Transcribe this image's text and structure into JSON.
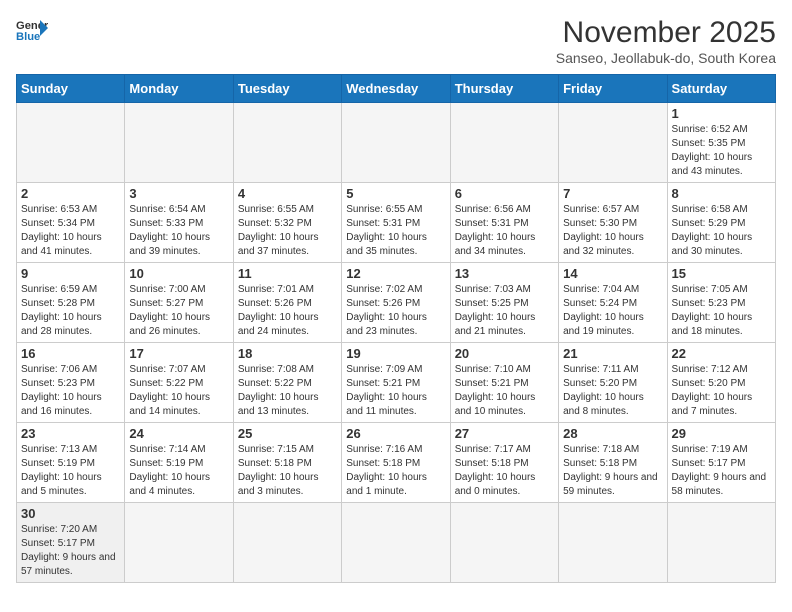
{
  "logo": {
    "text_general": "General",
    "text_blue": "Blue"
  },
  "header": {
    "month": "November 2025",
    "location": "Sanseo, Jeollabuk-do, South Korea"
  },
  "days_of_week": [
    "Sunday",
    "Monday",
    "Tuesday",
    "Wednesday",
    "Thursday",
    "Friday",
    "Saturday"
  ],
  "weeks": [
    [
      {
        "day": "",
        "info": ""
      },
      {
        "day": "",
        "info": ""
      },
      {
        "day": "",
        "info": ""
      },
      {
        "day": "",
        "info": ""
      },
      {
        "day": "",
        "info": ""
      },
      {
        "day": "",
        "info": ""
      },
      {
        "day": "1",
        "info": "Sunrise: 6:52 AM\nSunset: 5:35 PM\nDaylight: 10 hours and 43 minutes."
      }
    ],
    [
      {
        "day": "2",
        "info": "Sunrise: 6:53 AM\nSunset: 5:34 PM\nDaylight: 10 hours and 41 minutes."
      },
      {
        "day": "3",
        "info": "Sunrise: 6:54 AM\nSunset: 5:33 PM\nDaylight: 10 hours and 39 minutes."
      },
      {
        "day": "4",
        "info": "Sunrise: 6:55 AM\nSunset: 5:32 PM\nDaylight: 10 hours and 37 minutes."
      },
      {
        "day": "5",
        "info": "Sunrise: 6:55 AM\nSunset: 5:31 PM\nDaylight: 10 hours and 35 minutes."
      },
      {
        "day": "6",
        "info": "Sunrise: 6:56 AM\nSunset: 5:31 PM\nDaylight: 10 hours and 34 minutes."
      },
      {
        "day": "7",
        "info": "Sunrise: 6:57 AM\nSunset: 5:30 PM\nDaylight: 10 hours and 32 minutes."
      },
      {
        "day": "8",
        "info": "Sunrise: 6:58 AM\nSunset: 5:29 PM\nDaylight: 10 hours and 30 minutes."
      }
    ],
    [
      {
        "day": "9",
        "info": "Sunrise: 6:59 AM\nSunset: 5:28 PM\nDaylight: 10 hours and 28 minutes."
      },
      {
        "day": "10",
        "info": "Sunrise: 7:00 AM\nSunset: 5:27 PM\nDaylight: 10 hours and 26 minutes."
      },
      {
        "day": "11",
        "info": "Sunrise: 7:01 AM\nSunset: 5:26 PM\nDaylight: 10 hours and 24 minutes."
      },
      {
        "day": "12",
        "info": "Sunrise: 7:02 AM\nSunset: 5:26 PM\nDaylight: 10 hours and 23 minutes."
      },
      {
        "day": "13",
        "info": "Sunrise: 7:03 AM\nSunset: 5:25 PM\nDaylight: 10 hours and 21 minutes."
      },
      {
        "day": "14",
        "info": "Sunrise: 7:04 AM\nSunset: 5:24 PM\nDaylight: 10 hours and 19 minutes."
      },
      {
        "day": "15",
        "info": "Sunrise: 7:05 AM\nSunset: 5:23 PM\nDaylight: 10 hours and 18 minutes."
      }
    ],
    [
      {
        "day": "16",
        "info": "Sunrise: 7:06 AM\nSunset: 5:23 PM\nDaylight: 10 hours and 16 minutes."
      },
      {
        "day": "17",
        "info": "Sunrise: 7:07 AM\nSunset: 5:22 PM\nDaylight: 10 hours and 14 minutes."
      },
      {
        "day": "18",
        "info": "Sunrise: 7:08 AM\nSunset: 5:22 PM\nDaylight: 10 hours and 13 minutes."
      },
      {
        "day": "19",
        "info": "Sunrise: 7:09 AM\nSunset: 5:21 PM\nDaylight: 10 hours and 11 minutes."
      },
      {
        "day": "20",
        "info": "Sunrise: 7:10 AM\nSunset: 5:21 PM\nDaylight: 10 hours and 10 minutes."
      },
      {
        "day": "21",
        "info": "Sunrise: 7:11 AM\nSunset: 5:20 PM\nDaylight: 10 hours and 8 minutes."
      },
      {
        "day": "22",
        "info": "Sunrise: 7:12 AM\nSunset: 5:20 PM\nDaylight: 10 hours and 7 minutes."
      }
    ],
    [
      {
        "day": "23",
        "info": "Sunrise: 7:13 AM\nSunset: 5:19 PM\nDaylight: 10 hours and 5 minutes."
      },
      {
        "day": "24",
        "info": "Sunrise: 7:14 AM\nSunset: 5:19 PM\nDaylight: 10 hours and 4 minutes."
      },
      {
        "day": "25",
        "info": "Sunrise: 7:15 AM\nSunset: 5:18 PM\nDaylight: 10 hours and 3 minutes."
      },
      {
        "day": "26",
        "info": "Sunrise: 7:16 AM\nSunset: 5:18 PM\nDaylight: 10 hours and 1 minute."
      },
      {
        "day": "27",
        "info": "Sunrise: 7:17 AM\nSunset: 5:18 PM\nDaylight: 10 hours and 0 minutes."
      },
      {
        "day": "28",
        "info": "Sunrise: 7:18 AM\nSunset: 5:18 PM\nDaylight: 9 hours and 59 minutes."
      },
      {
        "day": "29",
        "info": "Sunrise: 7:19 AM\nSunset: 5:17 PM\nDaylight: 9 hours and 58 minutes."
      }
    ],
    [
      {
        "day": "30",
        "info": "Sunrise: 7:20 AM\nSunset: 5:17 PM\nDaylight: 9 hours and 57 minutes."
      },
      {
        "day": "",
        "info": ""
      },
      {
        "day": "",
        "info": ""
      },
      {
        "day": "",
        "info": ""
      },
      {
        "day": "",
        "info": ""
      },
      {
        "day": "",
        "info": ""
      },
      {
        "day": "",
        "info": ""
      }
    ]
  ]
}
